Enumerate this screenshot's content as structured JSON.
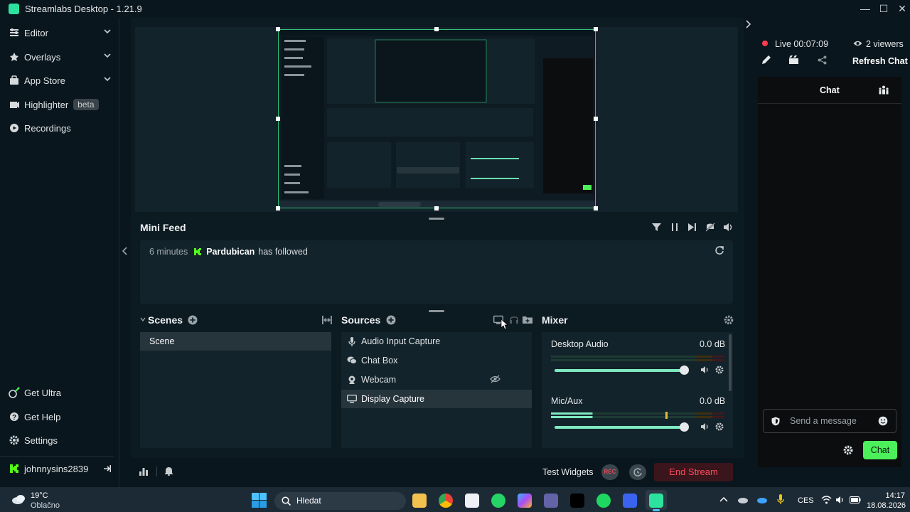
{
  "window": {
    "title": "Streamlabs Desktop - 1.21.9",
    "minimize": "—",
    "maximize": "☐",
    "close": "✕"
  },
  "nav": {
    "items": [
      {
        "label": "Editor",
        "icon": "editor-icon"
      },
      {
        "label": "Overlays",
        "icon": "overlays-icon"
      },
      {
        "label": "App Store",
        "icon": "app-store-icon"
      },
      {
        "label": "Highlighter",
        "icon": "highlighter-icon",
        "badge": "beta"
      },
      {
        "label": "Recordings",
        "icon": "recordings-icon"
      }
    ],
    "bottom": [
      {
        "label": "Get Ultra",
        "icon": "ultra-icon"
      },
      {
        "label": "Get Help",
        "icon": "help-icon"
      },
      {
        "label": "Settings",
        "icon": "settings-icon"
      }
    ],
    "user": "johnnysins2839"
  },
  "minifeed": {
    "title": "Mini Feed",
    "event": {
      "time": "6 minutes",
      "name": "Pardubican",
      "action": "has followed"
    }
  },
  "scenes": {
    "title": "Scenes",
    "items": [
      "Scene"
    ]
  },
  "sources": {
    "title": "Sources",
    "items": [
      {
        "label": "Audio Input Capture",
        "icon": "microphone-icon"
      },
      {
        "label": "Chat Box",
        "icon": "chat-icon"
      },
      {
        "label": "Webcam",
        "icon": "webcam-icon",
        "hidden": true
      },
      {
        "label": "Display Capture",
        "icon": "monitor-icon",
        "selected": true
      }
    ]
  },
  "mixer": {
    "title": "Mixer",
    "channels": [
      {
        "name": "Desktop Audio",
        "db": "0.0 dB",
        "volume": 1.0
      },
      {
        "name": "Mic/Aux",
        "db": "0.0 dB",
        "volume": 1.0
      }
    ]
  },
  "footer": {
    "test_widgets": "Test Widgets",
    "rec": "REC",
    "end_stream": "End Stream"
  },
  "live": {
    "time": "Live 00:07:09",
    "viewers": "2 viewers",
    "refresh_chat": "Refresh Chat"
  },
  "chat": {
    "title": "Chat",
    "placeholder": "Send a message",
    "send": "Chat"
  },
  "taskbar": {
    "weather_temp": "19°C",
    "weather_desc": "Oblačno",
    "search": "Hledat",
    "lang": "CES",
    "time": "14:17",
    "date": "18.08.2026"
  },
  "colors": {
    "accent": "#31c27a",
    "live_red": "#ff3b4e",
    "chat_green": "#4cf05a",
    "bg": "#09161d"
  }
}
